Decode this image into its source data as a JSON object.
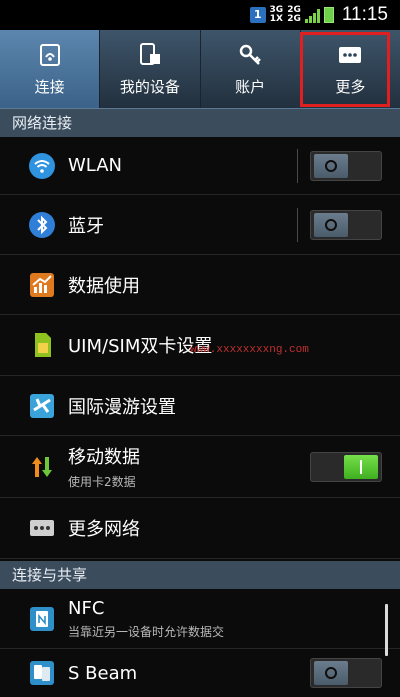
{
  "status_bar": {
    "sim_slot": "1",
    "network_1": [
      "3G",
      "1X"
    ],
    "network_2": [
      "2G",
      "2G"
    ],
    "time": "11:15"
  },
  "tabs": [
    {
      "label": "连接",
      "icon": "connections-icon",
      "active": true
    },
    {
      "label": "我的设备",
      "icon": "device-icon",
      "active": false
    },
    {
      "label": "账户",
      "icon": "key-icon",
      "active": false
    },
    {
      "label": "更多",
      "icon": "more-icon",
      "active": false
    }
  ],
  "sections": {
    "network": "网络连接",
    "sharing": "连接与共享"
  },
  "rows": {
    "wlan": {
      "label": "WLAN",
      "toggle": "off"
    },
    "bluetooth": {
      "label": "蓝牙",
      "toggle": "off"
    },
    "data_usage": {
      "label": "数据使用"
    },
    "sim": {
      "label": "UIM/SIM双卡设置"
    },
    "roaming": {
      "label": "国际漫游设置"
    },
    "mobile_data": {
      "label": "移动数据",
      "sub": "使用卡2数据",
      "toggle": "on"
    },
    "more_networks": {
      "label": "更多网络"
    },
    "nfc": {
      "label": "NFC",
      "sub": "当靠近另一设备时允许数据交"
    },
    "sbeam": {
      "label": "S Beam"
    }
  },
  "watermark": "www.xxxxxxxxng.com",
  "colors": {
    "tab_active": "#4e76a0",
    "section_header": "#3b4c5c",
    "toggle_on": "#5cc836",
    "highlight": "#e02020"
  }
}
